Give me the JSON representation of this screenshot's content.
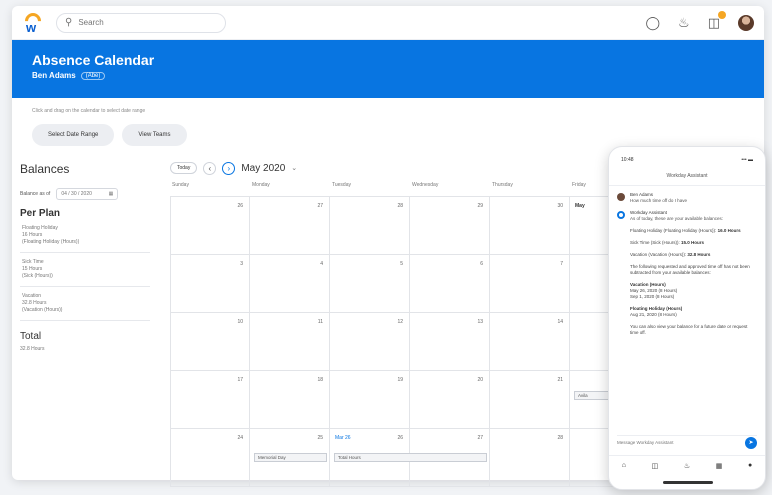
{
  "header": {
    "search_placeholder": "Search",
    "icons": [
      "logo-icon",
      "search-icon",
      "chat-icon",
      "bell-icon",
      "inbox-icon",
      "avatar"
    ]
  },
  "banner": {
    "title": "Absence Calendar",
    "worker": "Ben Adams",
    "worker_tag": "(Abe)"
  },
  "hint": "Click and drag on the calendar to select date range",
  "buttons": {
    "select_range": "Select Date Range",
    "view_teams": "View Teams"
  },
  "balances": {
    "heading": "Balances",
    "as_of_label": "Balance as of",
    "as_of_date": "04 / 30 / 2020",
    "per_plan_heading": "Per Plan",
    "plans": [
      {
        "lines": [
          "Floating Holiday",
          "16 Hours",
          "(Floating Holiday (Hours))"
        ]
      },
      {
        "lines": [
          "Sick Time",
          "15 Hours",
          "(Sick (Hours))"
        ]
      },
      {
        "lines": [
          "Vacation",
          "32.8 Hours",
          "(Vacation (Hours))"
        ]
      }
    ],
    "total_heading": "Total",
    "total_value": "32.8 Hours"
  },
  "calendar": {
    "today_label": "Today",
    "month_label": "May 2020",
    "days_of_week": [
      "Sunday",
      "Monday",
      "Tuesday",
      "Wednesday",
      "Thursday",
      "Friday"
    ],
    "weeks": [
      [
        "26",
        "27",
        "28",
        "29",
        "30",
        "May"
      ],
      [
        "3",
        "4",
        "5",
        "6",
        "7",
        ""
      ],
      [
        "10",
        "11",
        "12",
        "13",
        "14",
        ""
      ],
      [
        "17",
        "18",
        "19",
        "20",
        "21",
        ""
      ],
      [
        "24",
        "25",
        "26",
        "27",
        "28",
        ""
      ]
    ],
    "events": {
      "friday_wk4": "Avila",
      "memorial_day": "Memorial Day",
      "march_label": "Mar 26",
      "total_hours": "Total Hours"
    }
  },
  "phone": {
    "time": "10:48",
    "signal": "••• ▬",
    "title": "Workday Assistant",
    "user_name": "Ben Adams",
    "user_msg": "How much time off do I have",
    "bot_name": "Workday Assistant",
    "bot_intro": "As of today, these are your available balances:",
    "lines": [
      {
        "text": "Floating Holiday (Floating Holiday (Hours)):",
        "bold": "16.0 Hours"
      },
      {
        "text": "Sick Time (Sick (Hours)):",
        "bold": "15.0 Hours"
      },
      {
        "text": "Vacation (Vacation (Hours)):",
        "bold": "32.8 Hours"
      }
    ],
    "following": "The following requested and approved time off has not been subtracted from your available balances:",
    "req1_title": "Vacation (Hours)",
    "req1_lines": [
      "May 26, 2020 (8 Hours)",
      "Sep 1, 2020 (8 Hours)"
    ],
    "req2_title": "Floating Holiday (Hours)",
    "req2_lines": [
      "Aug 21, 2020 (8 Hours)"
    ],
    "closing": "You can also view your balance for a future date or request time off.",
    "input_placeholder": "Message Workday Assistant",
    "nav_icons": [
      "home-icon",
      "inbox-icon",
      "bell-icon",
      "apps-icon",
      "chat-icon"
    ]
  }
}
